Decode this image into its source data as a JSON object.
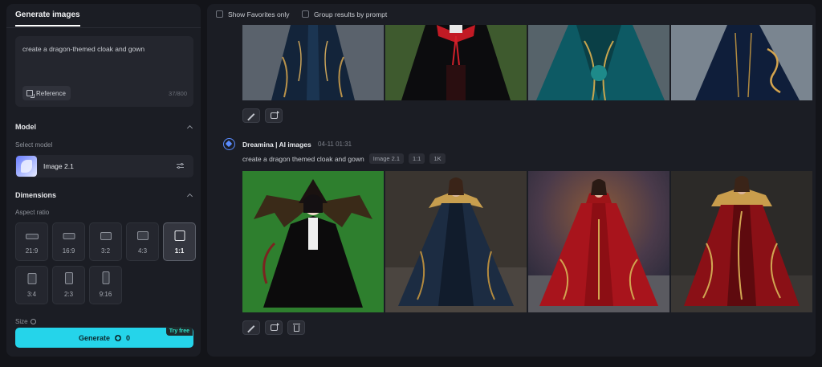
{
  "left": {
    "tab_label": "Generate images",
    "prompt": {
      "text": "create a dragon-themed cloak and gown",
      "reference_label": "Reference",
      "counter": "37/800"
    },
    "model": {
      "title": "Model",
      "select_label": "Select model",
      "selected": "Image 2.1"
    },
    "dimensions": {
      "title": "Dimensions",
      "aspect_label": "Aspect ratio",
      "ratios": [
        {
          "label": "21:9",
          "active": false
        },
        {
          "label": "16:9",
          "active": false
        },
        {
          "label": "3:2",
          "active": false
        },
        {
          "label": "4:3",
          "active": false
        },
        {
          "label": "1:1",
          "active": true
        },
        {
          "label": "3:4",
          "active": false
        },
        {
          "label": "2:3",
          "active": false
        },
        {
          "label": "9:16",
          "active": false
        }
      ],
      "size_label": "Size"
    },
    "generate": {
      "label": "Generate",
      "cost": "0",
      "badge": "Try free"
    }
  },
  "right": {
    "filters": {
      "favorites_label": "Show Favorites only",
      "group_label": "Group results by prompt"
    },
    "generation": {
      "author": "Dreamina | AI images",
      "time": "04-11  01:31",
      "prompt": "create a dragon themed cloak and gown",
      "tags": [
        "Image 2.1",
        "1:1",
        "1K"
      ]
    }
  },
  "colors": {
    "accent": "#25d4ea",
    "panel": "#1b1d24",
    "background": "#131419"
  }
}
